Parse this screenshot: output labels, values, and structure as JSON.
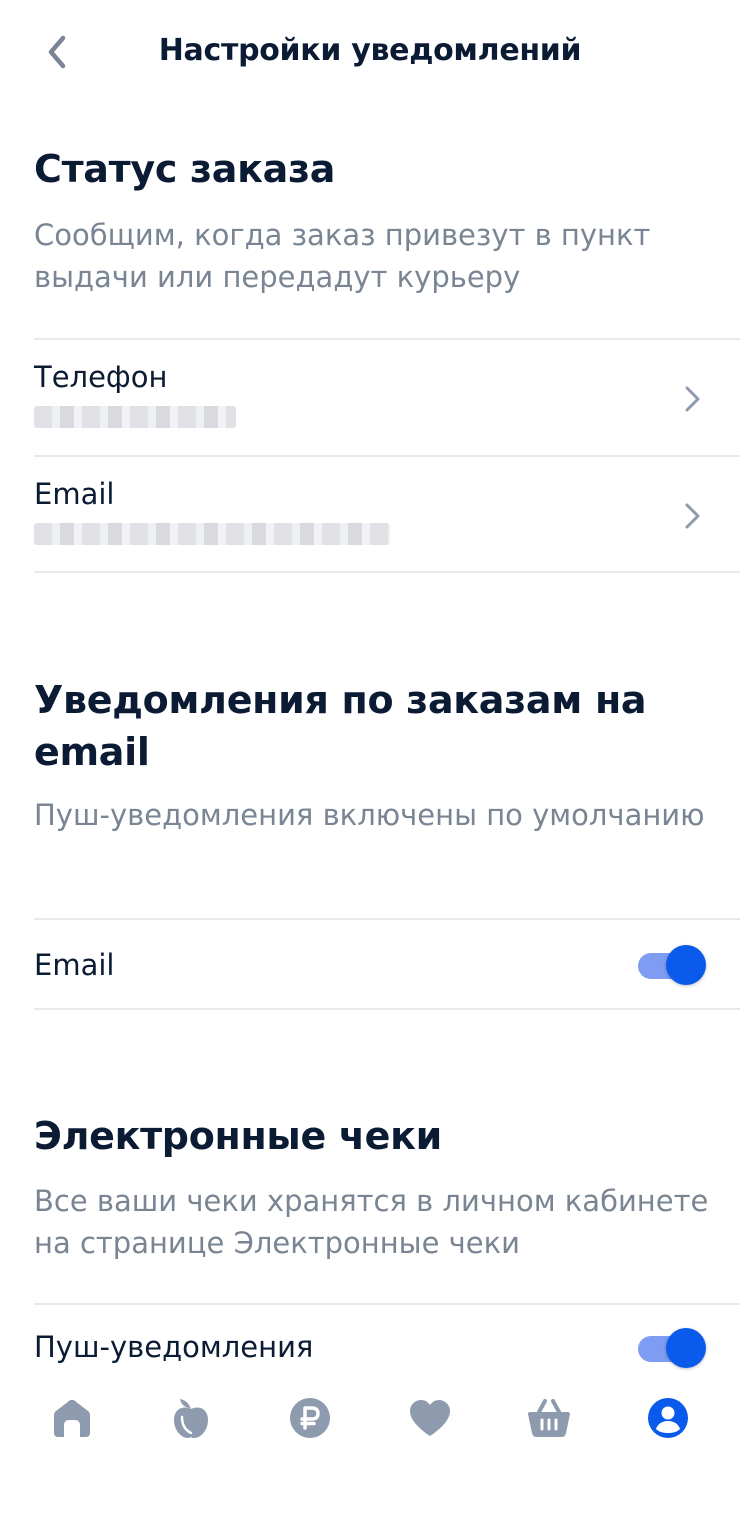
{
  "header": {
    "title": "Настройки уведомлений",
    "back_icon": "chevron-left-icon"
  },
  "order_status": {
    "title": "Статус заказа",
    "description": "Сообщим, когда заказ привезут в пункт выдачи или передадут курьеру",
    "phone": {
      "label": "Телефон"
    },
    "email": {
      "label": "Email"
    }
  },
  "email_notifications": {
    "title": "Уведомления по заказам на email",
    "description": "Пуш-уведомления включены по умолчанию",
    "email_toggle": {
      "label": "Email",
      "on": true
    }
  },
  "receipts": {
    "title": "Электронные чеки",
    "description": "Все ваши чеки хранятся в личном кабинете на странице Электронные чеки",
    "push_toggle": {
      "label": "Пуш-уведомления",
      "on": true
    }
  },
  "bottom_nav": {
    "items": [
      {
        "icon": "home-icon",
        "active": false
      },
      {
        "icon": "catalog-icon",
        "active": false
      },
      {
        "icon": "ruble-icon",
        "active": false
      },
      {
        "icon": "heart-icon",
        "active": false
      },
      {
        "icon": "basket-icon",
        "active": false
      },
      {
        "icon": "profile-icon",
        "active": true
      }
    ]
  },
  "colors": {
    "accent": "#0a5bec",
    "text": "#0b1b33",
    "muted": "#7a8594",
    "icon_gray": "#8e9aad",
    "divider": "#e6e9ee"
  }
}
